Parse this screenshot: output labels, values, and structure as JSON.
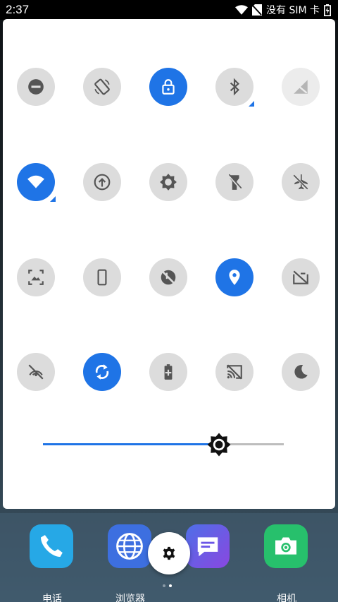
{
  "status_bar": {
    "time": "2:37",
    "no_sim_text": "没有 SIM 卡",
    "icons": [
      "wifi-icon",
      "no-sim-icon",
      "battery-icon"
    ]
  },
  "quick_settings": {
    "active_color": "#1f74e6",
    "inactive_color": "#dcdcdc",
    "tiles": [
      {
        "icon": "do-not-disturb-icon",
        "state": "off"
      },
      {
        "icon": "auto-rotate-icon",
        "state": "off"
      },
      {
        "icon": "rotation-lock-icon",
        "state": "on"
      },
      {
        "icon": "bluetooth-off-icon",
        "state": "off",
        "expandable": true
      },
      {
        "icon": "mobile-data-off-icon",
        "state": "unavailable"
      },
      {
        "icon": "wifi-icon",
        "state": "on",
        "expandable": true
      },
      {
        "icon": "hotspot-icon",
        "state": "off"
      },
      {
        "icon": "brightness-icon",
        "state": "off"
      },
      {
        "icon": "flashlight-icon",
        "state": "off"
      },
      {
        "icon": "airplane-mode-off-icon",
        "state": "off"
      },
      {
        "icon": "screenshot-icon",
        "state": "off"
      },
      {
        "icon": "phone-icon",
        "state": "off"
      },
      {
        "icon": "data-saver-off-icon",
        "state": "off"
      },
      {
        "icon": "location-icon",
        "state": "on"
      },
      {
        "icon": "screen-record-off-icon",
        "state": "off"
      },
      {
        "icon": "nfc-off-icon",
        "state": "off"
      },
      {
        "icon": "sync-icon",
        "state": "on"
      },
      {
        "icon": "battery-saver-icon",
        "state": "off"
      },
      {
        "icon": "cast-off-icon",
        "state": "off"
      },
      {
        "icon": "night-mode-icon",
        "state": "off"
      }
    ],
    "brightness": {
      "level": 0.73,
      "icon": "brightness-icon"
    }
  },
  "dock": {
    "apps": [
      {
        "label": "电话",
        "icon": "phone-app-icon",
        "color": "#26a8e6"
      },
      {
        "label": "浏览器",
        "icon": "browser-app-icon",
        "color": "#3d6fe0"
      },
      {
        "label": "",
        "icon": "messages-app-icon",
        "color": "#6b55e6"
      },
      {
        "label": "相机",
        "icon": "camera-app-icon",
        "color": "#27c06c"
      }
    ],
    "settings_icon": "gear-icon",
    "pages": 2,
    "current_page": 2
  }
}
